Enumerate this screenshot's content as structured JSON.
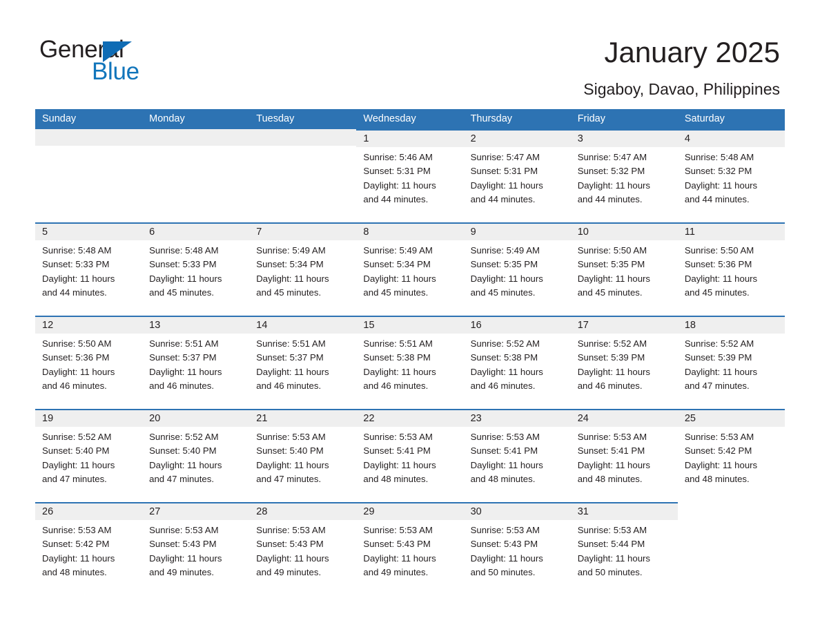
{
  "brand": {
    "name_part1": "General",
    "name_part2": "Blue",
    "triangle_icon": "triangle-flag-icon",
    "colors": {
      "black": "#231f20",
      "blue": "#1175bb",
      "header_blue": "#2d73b3",
      "day_strip_grey": "#efefef"
    }
  },
  "header": {
    "title": "January 2025",
    "location": "Sigaboy, Davao, Philippines"
  },
  "weekdays": [
    "Sunday",
    "Monday",
    "Tuesday",
    "Wednesday",
    "Thursday",
    "Friday",
    "Saturday"
  ],
  "weeks": [
    [
      {
        "day": "",
        "sunrise": "",
        "sunset": "",
        "daylight": "",
        "daylight2": "",
        "empty": true
      },
      {
        "day": "",
        "sunrise": "",
        "sunset": "",
        "daylight": "",
        "daylight2": "",
        "empty": true
      },
      {
        "day": "",
        "sunrise": "",
        "sunset": "",
        "daylight": "",
        "daylight2": "",
        "empty": true
      },
      {
        "day": "1",
        "sunrise": "Sunrise: 5:46 AM",
        "sunset": "Sunset: 5:31 PM",
        "daylight": "Daylight: 11 hours",
        "daylight2": "and 44 minutes.",
        "empty": false
      },
      {
        "day": "2",
        "sunrise": "Sunrise: 5:47 AM",
        "sunset": "Sunset: 5:31 PM",
        "daylight": "Daylight: 11 hours",
        "daylight2": "and 44 minutes.",
        "empty": false
      },
      {
        "day": "3",
        "sunrise": "Sunrise: 5:47 AM",
        "sunset": "Sunset: 5:32 PM",
        "daylight": "Daylight: 11 hours",
        "daylight2": "and 44 minutes.",
        "empty": false
      },
      {
        "day": "4",
        "sunrise": "Sunrise: 5:48 AM",
        "sunset": "Sunset: 5:32 PM",
        "daylight": "Daylight: 11 hours",
        "daylight2": "and 44 minutes.",
        "empty": false
      }
    ],
    [
      {
        "day": "5",
        "sunrise": "Sunrise: 5:48 AM",
        "sunset": "Sunset: 5:33 PM",
        "daylight": "Daylight: 11 hours",
        "daylight2": "and 44 minutes.",
        "empty": false
      },
      {
        "day": "6",
        "sunrise": "Sunrise: 5:48 AM",
        "sunset": "Sunset: 5:33 PM",
        "daylight": "Daylight: 11 hours",
        "daylight2": "and 45 minutes.",
        "empty": false
      },
      {
        "day": "7",
        "sunrise": "Sunrise: 5:49 AM",
        "sunset": "Sunset: 5:34 PM",
        "daylight": "Daylight: 11 hours",
        "daylight2": "and 45 minutes.",
        "empty": false
      },
      {
        "day": "8",
        "sunrise": "Sunrise: 5:49 AM",
        "sunset": "Sunset: 5:34 PM",
        "daylight": "Daylight: 11 hours",
        "daylight2": "and 45 minutes.",
        "empty": false
      },
      {
        "day": "9",
        "sunrise": "Sunrise: 5:49 AM",
        "sunset": "Sunset: 5:35 PM",
        "daylight": "Daylight: 11 hours",
        "daylight2": "and 45 minutes.",
        "empty": false
      },
      {
        "day": "10",
        "sunrise": "Sunrise: 5:50 AM",
        "sunset": "Sunset: 5:35 PM",
        "daylight": "Daylight: 11 hours",
        "daylight2": "and 45 minutes.",
        "empty": false
      },
      {
        "day": "11",
        "sunrise": "Sunrise: 5:50 AM",
        "sunset": "Sunset: 5:36 PM",
        "daylight": "Daylight: 11 hours",
        "daylight2": "and 45 minutes.",
        "empty": false
      }
    ],
    [
      {
        "day": "12",
        "sunrise": "Sunrise: 5:50 AM",
        "sunset": "Sunset: 5:36 PM",
        "daylight": "Daylight: 11 hours",
        "daylight2": "and 46 minutes.",
        "empty": false
      },
      {
        "day": "13",
        "sunrise": "Sunrise: 5:51 AM",
        "sunset": "Sunset: 5:37 PM",
        "daylight": "Daylight: 11 hours",
        "daylight2": "and 46 minutes.",
        "empty": false
      },
      {
        "day": "14",
        "sunrise": "Sunrise: 5:51 AM",
        "sunset": "Sunset: 5:37 PM",
        "daylight": "Daylight: 11 hours",
        "daylight2": "and 46 minutes.",
        "empty": false
      },
      {
        "day": "15",
        "sunrise": "Sunrise: 5:51 AM",
        "sunset": "Sunset: 5:38 PM",
        "daylight": "Daylight: 11 hours",
        "daylight2": "and 46 minutes.",
        "empty": false
      },
      {
        "day": "16",
        "sunrise": "Sunrise: 5:52 AM",
        "sunset": "Sunset: 5:38 PM",
        "daylight": "Daylight: 11 hours",
        "daylight2": "and 46 minutes.",
        "empty": false
      },
      {
        "day": "17",
        "sunrise": "Sunrise: 5:52 AM",
        "sunset": "Sunset: 5:39 PM",
        "daylight": "Daylight: 11 hours",
        "daylight2": "and 46 minutes.",
        "empty": false
      },
      {
        "day": "18",
        "sunrise": "Sunrise: 5:52 AM",
        "sunset": "Sunset: 5:39 PM",
        "daylight": "Daylight: 11 hours",
        "daylight2": "and 47 minutes.",
        "empty": false
      }
    ],
    [
      {
        "day": "19",
        "sunrise": "Sunrise: 5:52 AM",
        "sunset": "Sunset: 5:40 PM",
        "daylight": "Daylight: 11 hours",
        "daylight2": "and 47 minutes.",
        "empty": false
      },
      {
        "day": "20",
        "sunrise": "Sunrise: 5:52 AM",
        "sunset": "Sunset: 5:40 PM",
        "daylight": "Daylight: 11 hours",
        "daylight2": "and 47 minutes.",
        "empty": false
      },
      {
        "day": "21",
        "sunrise": "Sunrise: 5:53 AM",
        "sunset": "Sunset: 5:40 PM",
        "daylight": "Daylight: 11 hours",
        "daylight2": "and 47 minutes.",
        "empty": false
      },
      {
        "day": "22",
        "sunrise": "Sunrise: 5:53 AM",
        "sunset": "Sunset: 5:41 PM",
        "daylight": "Daylight: 11 hours",
        "daylight2": "and 48 minutes.",
        "empty": false
      },
      {
        "day": "23",
        "sunrise": "Sunrise: 5:53 AM",
        "sunset": "Sunset: 5:41 PM",
        "daylight": "Daylight: 11 hours",
        "daylight2": "and 48 minutes.",
        "empty": false
      },
      {
        "day": "24",
        "sunrise": "Sunrise: 5:53 AM",
        "sunset": "Sunset: 5:41 PM",
        "daylight": "Daylight: 11 hours",
        "daylight2": "and 48 minutes.",
        "empty": false
      },
      {
        "day": "25",
        "sunrise": "Sunrise: 5:53 AM",
        "sunset": "Sunset: 5:42 PM",
        "daylight": "Daylight: 11 hours",
        "daylight2": "and 48 minutes.",
        "empty": false
      }
    ],
    [
      {
        "day": "26",
        "sunrise": "Sunrise: 5:53 AM",
        "sunset": "Sunset: 5:42 PM",
        "daylight": "Daylight: 11 hours",
        "daylight2": "and 48 minutes.",
        "empty": false
      },
      {
        "day": "27",
        "sunrise": "Sunrise: 5:53 AM",
        "sunset": "Sunset: 5:43 PM",
        "daylight": "Daylight: 11 hours",
        "daylight2": "and 49 minutes.",
        "empty": false
      },
      {
        "day": "28",
        "sunrise": "Sunrise: 5:53 AM",
        "sunset": "Sunset: 5:43 PM",
        "daylight": "Daylight: 11 hours",
        "daylight2": "and 49 minutes.",
        "empty": false
      },
      {
        "day": "29",
        "sunrise": "Sunrise: 5:53 AM",
        "sunset": "Sunset: 5:43 PM",
        "daylight": "Daylight: 11 hours",
        "daylight2": "and 49 minutes.",
        "empty": false
      },
      {
        "day": "30",
        "sunrise": "Sunrise: 5:53 AM",
        "sunset": "Sunset: 5:43 PM",
        "daylight": "Daylight: 11 hours",
        "daylight2": "and 50 minutes.",
        "empty": false
      },
      {
        "day": "31",
        "sunrise": "Sunrise: 5:53 AM",
        "sunset": "Sunset: 5:44 PM",
        "daylight": "Daylight: 11 hours",
        "daylight2": "and 50 minutes.",
        "empty": false
      },
      {
        "day": "",
        "sunrise": "",
        "sunset": "",
        "daylight": "",
        "daylight2": "",
        "empty": true
      }
    ]
  ]
}
